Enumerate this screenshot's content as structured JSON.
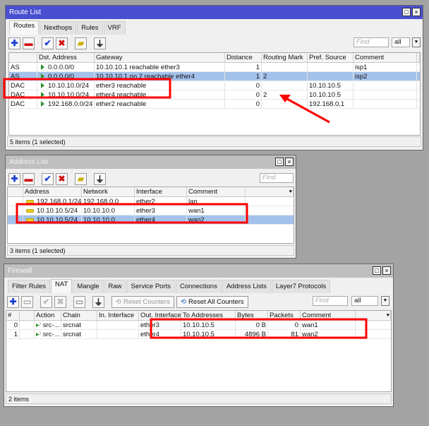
{
  "route_list": {
    "title": "Route List",
    "tabs": [
      "Routes",
      "Nexthops",
      "Rules",
      "VRF"
    ],
    "find_placeholder": "Find",
    "filter_value": "all",
    "columns": [
      "",
      "Dst. Address",
      "Gateway",
      "Distance",
      "Routing Mark",
      "Pref. Source",
      "Comment"
    ],
    "rows": [
      [
        "AS",
        "0.0.0.0/0",
        "10.10.10.1 reachable ether3",
        "1",
        "",
        "",
        "isp1"
      ],
      [
        "AS",
        "0.0.0.0/0",
        "10.10.10.1 on 2 reachable ether4",
        "1",
        "2",
        "",
        "isp2"
      ],
      [
        "DAC",
        "10.10.10.0/24",
        "ether3 reachable",
        "0",
        "",
        "10.10.10.5",
        ""
      ],
      [
        "DAC",
        "10.10.10.0/24",
        "ether4 reachable",
        "0",
        "2",
        "10.10.10.5",
        ""
      ],
      [
        "DAC",
        "192.168.0.0/24",
        "ether2 reachable",
        "0",
        "",
        "192.168.0.1",
        ""
      ]
    ],
    "selected_row": 1,
    "status": "5 items (1 selected)"
  },
  "address_list": {
    "title": "Address List",
    "find_placeholder": "Find",
    "columns": [
      "",
      "Address",
      "Network",
      "Interface",
      "Comment"
    ],
    "rows": [
      [
        "",
        "192.168.0.1/24",
        "192.168.0.0",
        "ether2",
        "lan"
      ],
      [
        "",
        "10.10.10.5/24",
        "10.10.10.0",
        "ether3",
        "wan1"
      ],
      [
        "",
        "10.10.10.5/24",
        "10.10.10.0",
        "ether4",
        "wan2"
      ]
    ],
    "selected_row": 2,
    "status": "3 items (1 selected)"
  },
  "firewall": {
    "title": "Firewall",
    "tabs": [
      "Filter Rules",
      "NAT",
      "Mangle",
      "Raw",
      "Service Ports",
      "Connections",
      "Address Lists",
      "Layer7 Protocols"
    ],
    "reset_counters": "Reset Counters",
    "reset_all_counters": "Reset All Counters",
    "find_placeholder": "Find",
    "filter_value": "all",
    "columns": [
      "#",
      "",
      "Action",
      "Chain",
      "In. Interface",
      "Out. Interface",
      "To Addresses",
      "Bytes",
      "Packets",
      "Comment"
    ],
    "rows": [
      [
        "0",
        "",
        "src-...",
        "srcnat",
        "",
        "ether3",
        "10.10.10.5",
        "0 B",
        "0",
        "wan1"
      ],
      [
        "1",
        "",
        "src-...",
        "srcnat",
        "",
        "ether4",
        "10.10.10.5",
        "4896 B",
        "81",
        "wan2"
      ]
    ],
    "status": "2 items"
  },
  "colors": {
    "highlight": "#ff0000",
    "title_active": "#4a4fcf",
    "selection": "#a4c2eb"
  }
}
